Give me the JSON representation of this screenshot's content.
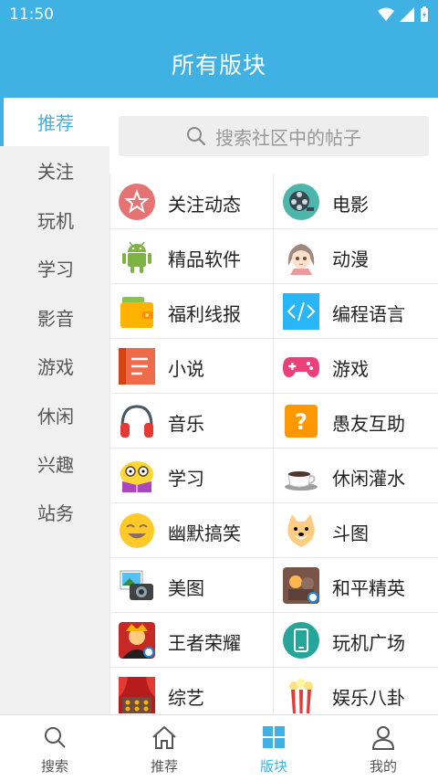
{
  "status_bar": {
    "time": "11:50"
  },
  "header": {
    "title": "所有版块"
  },
  "sidebar": {
    "items": [
      {
        "label": "推荐",
        "active": true
      },
      {
        "label": "关注"
      },
      {
        "label": "玩机"
      },
      {
        "label": "学习"
      },
      {
        "label": "影音"
      },
      {
        "label": "游戏"
      },
      {
        "label": "休闲"
      },
      {
        "label": "兴趣"
      },
      {
        "label": "站务"
      }
    ]
  },
  "search": {
    "placeholder": "搜索社区中的帖子"
  },
  "boards": [
    {
      "label": "关注动态",
      "icon": "star-badge-icon"
    },
    {
      "label": "电影",
      "icon": "film-reel-icon"
    },
    {
      "label": "精品软件",
      "icon": "android-icon"
    },
    {
      "label": "动漫",
      "icon": "anime-girl-icon"
    },
    {
      "label": "福利线报",
      "icon": "wallet-icon"
    },
    {
      "label": "编程语言",
      "icon": "code-icon"
    },
    {
      "label": "小说",
      "icon": "book-icon"
    },
    {
      "label": "游戏",
      "icon": "gamepad-icon"
    },
    {
      "label": "音乐",
      "icon": "headphones-icon"
    },
    {
      "label": "愚友互助",
      "icon": "question-icon"
    },
    {
      "label": "学习",
      "icon": "study-emoji-icon"
    },
    {
      "label": "休闲灌水",
      "icon": "coffee-cup-icon"
    },
    {
      "label": "幽默搞笑",
      "icon": "laugh-emoji-icon"
    },
    {
      "label": "斗图",
      "icon": "doge-icon"
    },
    {
      "label": "美图",
      "icon": "camera-photo-icon"
    },
    {
      "label": "和平精英",
      "icon": "peace-elite-icon"
    },
    {
      "label": "王者荣耀",
      "icon": "honor-of-kings-icon"
    },
    {
      "label": "玩机广场",
      "icon": "phone-icon"
    },
    {
      "label": "综艺",
      "icon": "theater-icon"
    },
    {
      "label": "娱乐八卦",
      "icon": "popcorn-icon"
    }
  ],
  "bottom_nav": [
    {
      "label": "搜索",
      "icon": "search-icon"
    },
    {
      "label": "推荐",
      "icon": "home-icon"
    },
    {
      "label": "版块",
      "icon": "grid-icon",
      "active": true
    },
    {
      "label": "我的",
      "icon": "user-icon"
    }
  ],
  "colors": {
    "accent": "#3fb1e3",
    "sidebar_bg": "#f0f0f0"
  }
}
